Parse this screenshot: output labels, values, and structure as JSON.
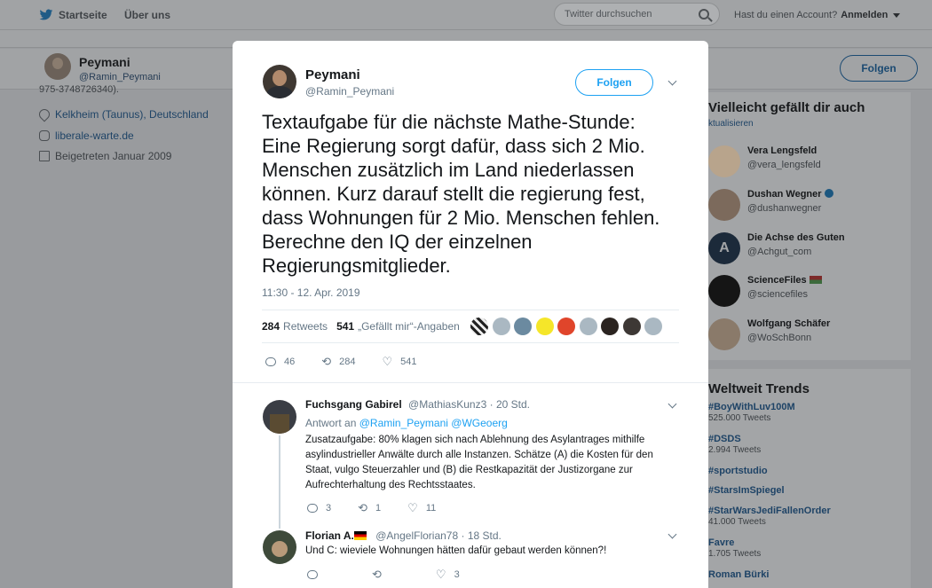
{
  "topbar": {
    "home_label": "Startseite",
    "about_label": "Über uns",
    "search_placeholder": "Twitter durchsuchen",
    "account_question": "Hast du einen Account?",
    "login_label": "Anmelden"
  },
  "profile": {
    "name": "Peymani",
    "handle": "@Ramin_Peymani",
    "cut_text": "975-3748726340).",
    "location": "Kelkheim (Taunus), Deutschland",
    "website": "liberale-warte.de",
    "joined": "Beigetreten Januar 2009",
    "follow_label": "Folgen"
  },
  "recommendations": {
    "title": "Vielleicht gefällt dir auch",
    "refresh": "ktualisieren",
    "users": [
      {
        "name": "Vera Lengsfeld",
        "handle": "@vera_lengsfeld"
      },
      {
        "name": "Dushan Wegner",
        "handle": "@dushanwegner"
      },
      {
        "name": "Die Achse des Guten",
        "handle": "@Achgut_com"
      },
      {
        "name": "ScienceFiles",
        "handle": "@sciencefiles"
      },
      {
        "name": "Wolfgang Schäfer",
        "handle": "@WoSchBonn"
      }
    ]
  },
  "trends": {
    "title": "Weltweit Trends",
    "items": [
      {
        "name": "#BoyWithLuv100M",
        "count": "525.000 Tweets"
      },
      {
        "name": "#DSDS",
        "count": "2.994 Tweets"
      },
      {
        "name": "#sportstudio",
        "count": ""
      },
      {
        "name": "#StarsImSpiegel",
        "count": ""
      },
      {
        "name": "#StarWarsJediFallenOrder",
        "count": "41.000 Tweets"
      },
      {
        "name": "Favre",
        "count": "1.705 Tweets"
      },
      {
        "name": "Roman Bürki",
        "count": ""
      }
    ]
  },
  "tweet": {
    "name": "Peymani",
    "handle": "@Ramin_Peymani",
    "follow_label": "Folgen",
    "text": "Textaufgabe für die nächste Mathe-Stunde: Eine Regierung sorgt dafür, dass sich 2 Mio. Menschen zusätzlich im Land niederlassen können. Kurz darauf stellt die regierung fest, dass Wohnungen für 2 Mio. Menschen fehlen. Berechne den IQ der einzelnen Regierungsmitglieder.",
    "timestamp": "11:30 - 12. Apr. 2019",
    "retweets_count": "284",
    "retweets_label": "Retweets",
    "likes_count": "541",
    "likes_label": "„Gefällt mir“-Angaben",
    "actions": {
      "replies": "46",
      "retweets": "284",
      "likes": "541"
    }
  },
  "replies": [
    {
      "name": "Fuchsgang Gabirel",
      "handle": "@MathiasKunz3",
      "time": "· 20 Std.",
      "reply_prefix": "Antwort an",
      "reply_to": "@Ramin_Peymani @WGeoerg",
      "text": "Zusatzaufgabe: 80% klagen sich nach Ablehnung des Asylantrages mithilfe asylindustrieller Anwälte durch alle Instanzen. Schätze (A) die Kosten für den Staat, vulgo Steuerzahler und (B) die Restkapazität der Justizorgane zur Aufrechterhaltung des Rechtsstaates.",
      "actions": {
        "replies": "3",
        "retweets": "1",
        "likes": "11"
      }
    },
    {
      "name": "Florian A.",
      "handle": "@AngelFlorian78",
      "time": "· 18 Std.",
      "text": "Und C: wieviele Wohnungen hätten dafür gebaut werden können?!",
      "actions": {
        "replies": "",
        "retweets": "",
        "likes": "3"
      }
    }
  ],
  "colors": {
    "accent": "#1da1f2",
    "overlay": "#999b9e",
    "modal_bg": "#ffffff"
  }
}
